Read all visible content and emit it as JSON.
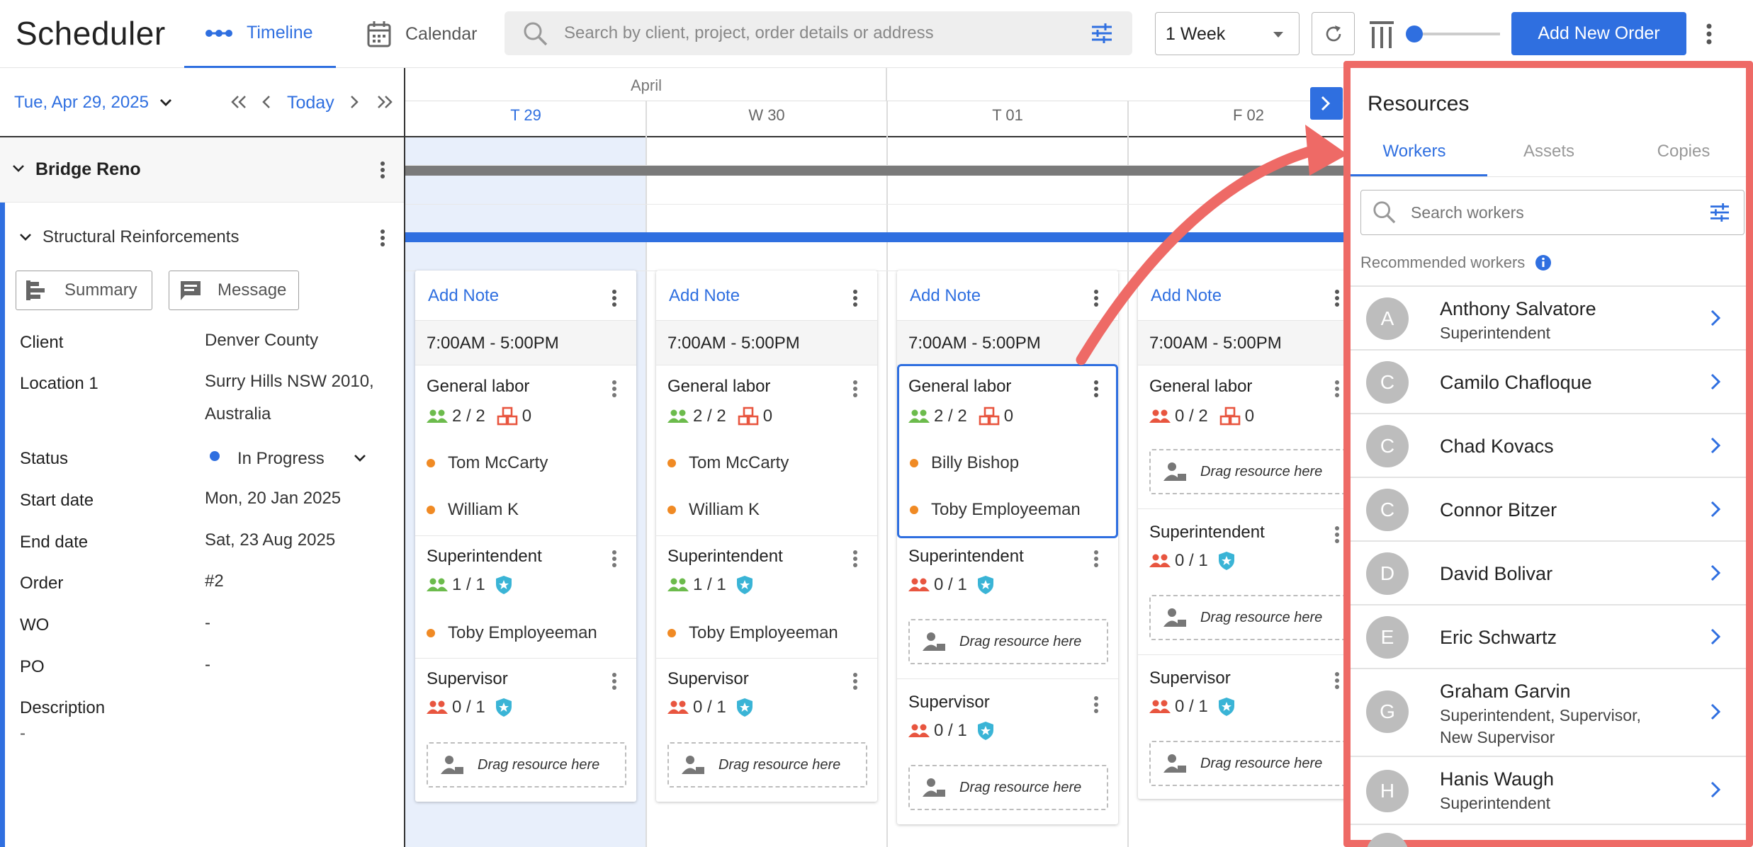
{
  "app": {
    "title": "Scheduler"
  },
  "nav": {
    "timeline": "Timeline",
    "calendar": "Calendar"
  },
  "search": {
    "placeholder": "Search by client, project, order details or address"
  },
  "toolbar": {
    "week": "1 Week",
    "add_order": "Add New Order",
    "zoom_level": 0.1
  },
  "datebar": {
    "date": "Tue, Apr 29, 2025",
    "today": "Today"
  },
  "project": {
    "name": "Bridge Reno",
    "sub": "Structural Reinforcements",
    "summary": "Summary",
    "message": "Message"
  },
  "details": {
    "client_label": "Client",
    "client": "Denver County",
    "location_label": "Location 1",
    "location_1": "Surry Hills NSW 2010,",
    "location_2": "Australia",
    "status_label": "Status",
    "status": "In Progress",
    "start_label": "Start date",
    "start": "Mon, 20 Jan 2025",
    "end_label": "End date",
    "end": "Sat, 23 Aug 2025",
    "order_label": "Order",
    "order": "#2",
    "wo_label": "WO",
    "wo": "-",
    "po_label": "PO",
    "po": "-",
    "desc_label": "Description",
    "desc": "-"
  },
  "timeline": {
    "month": "April",
    "days": [
      "T 29",
      "W 30",
      "T 01",
      "F 02"
    ],
    "add_note": "Add Note",
    "hours": "7:00AM - 5:00PM",
    "drag": "Drag resource here",
    "cards": [
      {
        "gl_role": "General labor",
        "gl_count": "2 / 2",
        "gl_assets": "0",
        "gl_p1": "Tom McCarty",
        "gl_p2": "William K",
        "su_role": "Superintendent",
        "su_count": "1 / 1",
        "su_p1": "Toby Employeeman",
        "sv_role": "Supervisor",
        "sv_count": "0 / 1"
      },
      {
        "gl_role": "General labor",
        "gl_count": "2 / 2",
        "gl_assets": "0",
        "gl_p1": "Tom McCarty",
        "gl_p2": "William K",
        "su_role": "Superintendent",
        "su_count": "1 / 1",
        "su_p1": "Toby Employeeman",
        "sv_role": "Supervisor",
        "sv_count": "0 / 1"
      },
      {
        "gl_role": "General labor",
        "gl_count": "2 / 2",
        "gl_assets": "0",
        "gl_p1": "Billy Bishop",
        "gl_p2": "Toby Employeeman",
        "su_role": "Superintendent",
        "su_count": "0 / 1",
        "sv_role": "Supervisor",
        "sv_count": "0 / 1"
      },
      {
        "gl_role": "General labor",
        "gl_count": "0 / 2",
        "gl_assets": "0",
        "su_role": "Superintendent",
        "su_count": "0 / 1",
        "sv_role": "Supervisor",
        "sv_count": "0 / 1"
      }
    ]
  },
  "resources": {
    "title": "Resources",
    "tabs": [
      "Workers",
      "Assets",
      "Copies"
    ],
    "search_placeholder": "Search workers",
    "recommended": "Recommended workers",
    "workers": [
      {
        "initial": "A",
        "name": "Anthony Salvatore",
        "role": "Superintendent"
      },
      {
        "initial": "C",
        "name": "Camilo Chafloque",
        "role": ""
      },
      {
        "initial": "C",
        "name": "Chad Kovacs",
        "role": ""
      },
      {
        "initial": "C",
        "name": "Connor Bitzer",
        "role": ""
      },
      {
        "initial": "D",
        "name": "David Bolivar",
        "role": ""
      },
      {
        "initial": "E",
        "name": "Eric Schwartz",
        "role": ""
      },
      {
        "initial": "G",
        "name": "Graham Garvin",
        "role": "Superintendent, Supervisor,",
        "role2": "New Supervisor"
      },
      {
        "initial": "H",
        "name": "Hanis Waugh",
        "role": "Superintendent"
      }
    ]
  },
  "colors": {
    "accent": "#2f6fe0",
    "highlight": "#ee6a66",
    "status_dot": "#f08a24",
    "in_progress": "#2f6fe0",
    "short": "#e8553f",
    "full": "#6cbb4c"
  }
}
